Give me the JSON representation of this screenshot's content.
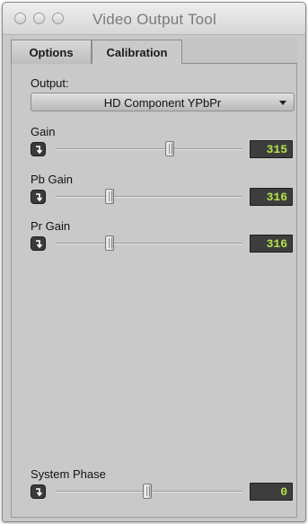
{
  "window": {
    "title": "Video Output Tool"
  },
  "tabs": [
    {
      "label": "Options",
      "active": false
    },
    {
      "label": "Calibration",
      "active": true
    }
  ],
  "output": {
    "label": "Output:",
    "selected": "HD Component YPbPr"
  },
  "sliders": {
    "gain": {
      "label": "Gain",
      "value": "315",
      "level": 0.61
    },
    "pb_gain": {
      "label": "Pb Gain",
      "value": "316",
      "level": 0.29
    },
    "pr_gain": {
      "label": "Pr Gain",
      "value": "316",
      "level": 0.29
    },
    "system_phase": {
      "label": "System Phase",
      "value": "0",
      "level": 0.49
    }
  },
  "colors": {
    "value_text": "#b6e24a",
    "value_bg": "#3d3d3d",
    "panel_bg": "#c9c9c9"
  },
  "icons": {
    "slider_reset": "reset-arrow-icon",
    "dropdown": "chevron-down-icon"
  }
}
